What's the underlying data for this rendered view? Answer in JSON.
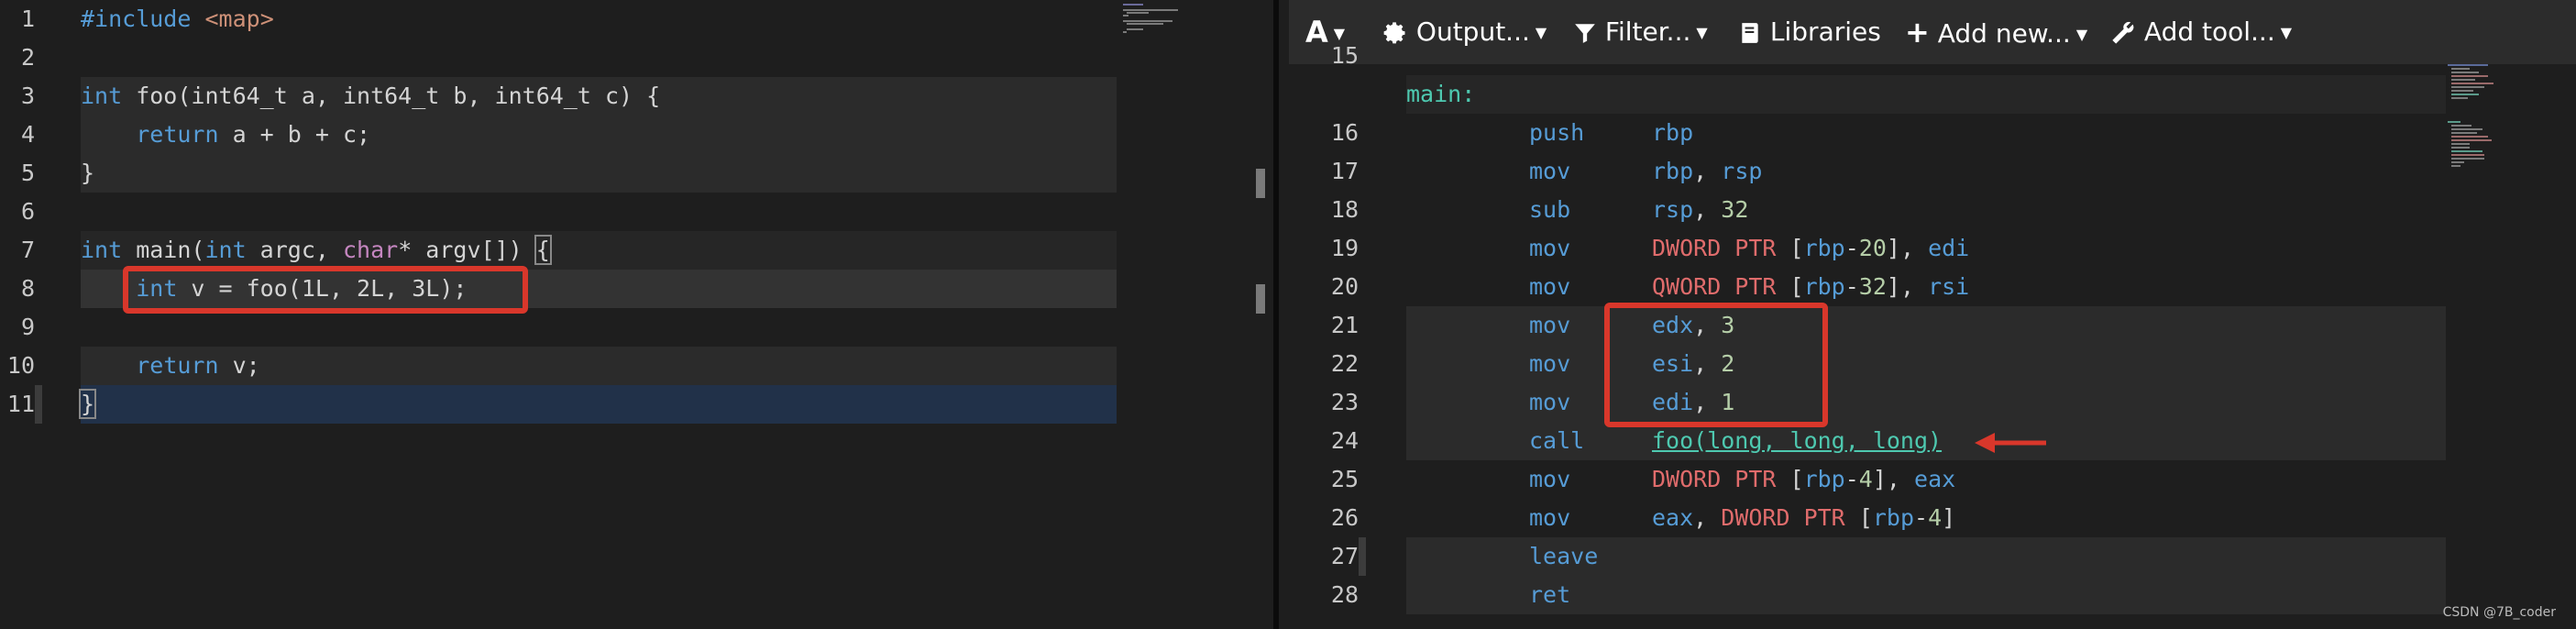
{
  "source_editor": {
    "lines": [
      {
        "n": "1"
      },
      {
        "n": "2"
      },
      {
        "n": "3"
      },
      {
        "n": "4"
      },
      {
        "n": "5"
      },
      {
        "n": "6"
      },
      {
        "n": "7"
      },
      {
        "n": "8"
      },
      {
        "n": "9"
      },
      {
        "n": "10"
      },
      {
        "n": "11"
      }
    ],
    "tokens": {
      "l1_a": "#include",
      "l1_b": "<map>",
      "l3_kw": "int",
      "l3_rest": " foo(int64_t a, int64_t b, int64_t c) {",
      "l4_kw": "return",
      "l4_rest": " a + b + c;",
      "l5": "}",
      "l7_kw1": "int",
      "l7_a": " main(",
      "l7_kw2": "int",
      "l7_b": " argc, ",
      "l7_kw3": "char",
      "l7_c": "* argv[]) ",
      "l7_d": "{",
      "l8_kw": "int",
      "l8_rest": " v = foo(1L, 2L, 3L);",
      "l10_kw": "return",
      "l10_rest": " v;",
      "l11": "}"
    }
  },
  "toolbar": {
    "font_label": "A",
    "output_label": "Output...",
    "filter_label": "Filter...",
    "libraries_label": "Libraries",
    "add_new_label": "Add new...",
    "add_tool_label": "Add tool..."
  },
  "asm_editor": {
    "lines": [
      {
        "n": "15"
      },
      {
        "n": "16"
      },
      {
        "n": "17"
      },
      {
        "n": "18"
      },
      {
        "n": "19"
      },
      {
        "n": "20"
      },
      {
        "n": "21"
      },
      {
        "n": "22"
      },
      {
        "n": "23"
      },
      {
        "n": "24"
      },
      {
        "n": "25"
      },
      {
        "n": "26"
      },
      {
        "n": "27"
      },
      {
        "n": "28"
      }
    ],
    "label_main": "main:",
    "instr": {
      "push": "push",
      "mov": "mov",
      "sub": "sub",
      "call": "call",
      "leave": "leave",
      "ret": "ret",
      "rbp": "rbp",
      "rsp": "rsp",
      "edi": "edi",
      "rsi": "rsi",
      "edx": "edx",
      "esi": "esi",
      "eax": "eax",
      "dword_ptr": "DWORD PTR",
      "qword_ptr": "QWORD PTR",
      "n32": "32",
      "n20": "20",
      "n3": "3",
      "n2": "2",
      "n1": "1",
      "n4": "4",
      "call_target": "foo(long, long, long)"
    }
  },
  "watermark": "CSDN @7B_coder",
  "colors": {
    "highlight_box": "#d9372b",
    "arrow": "#d9372b"
  }
}
